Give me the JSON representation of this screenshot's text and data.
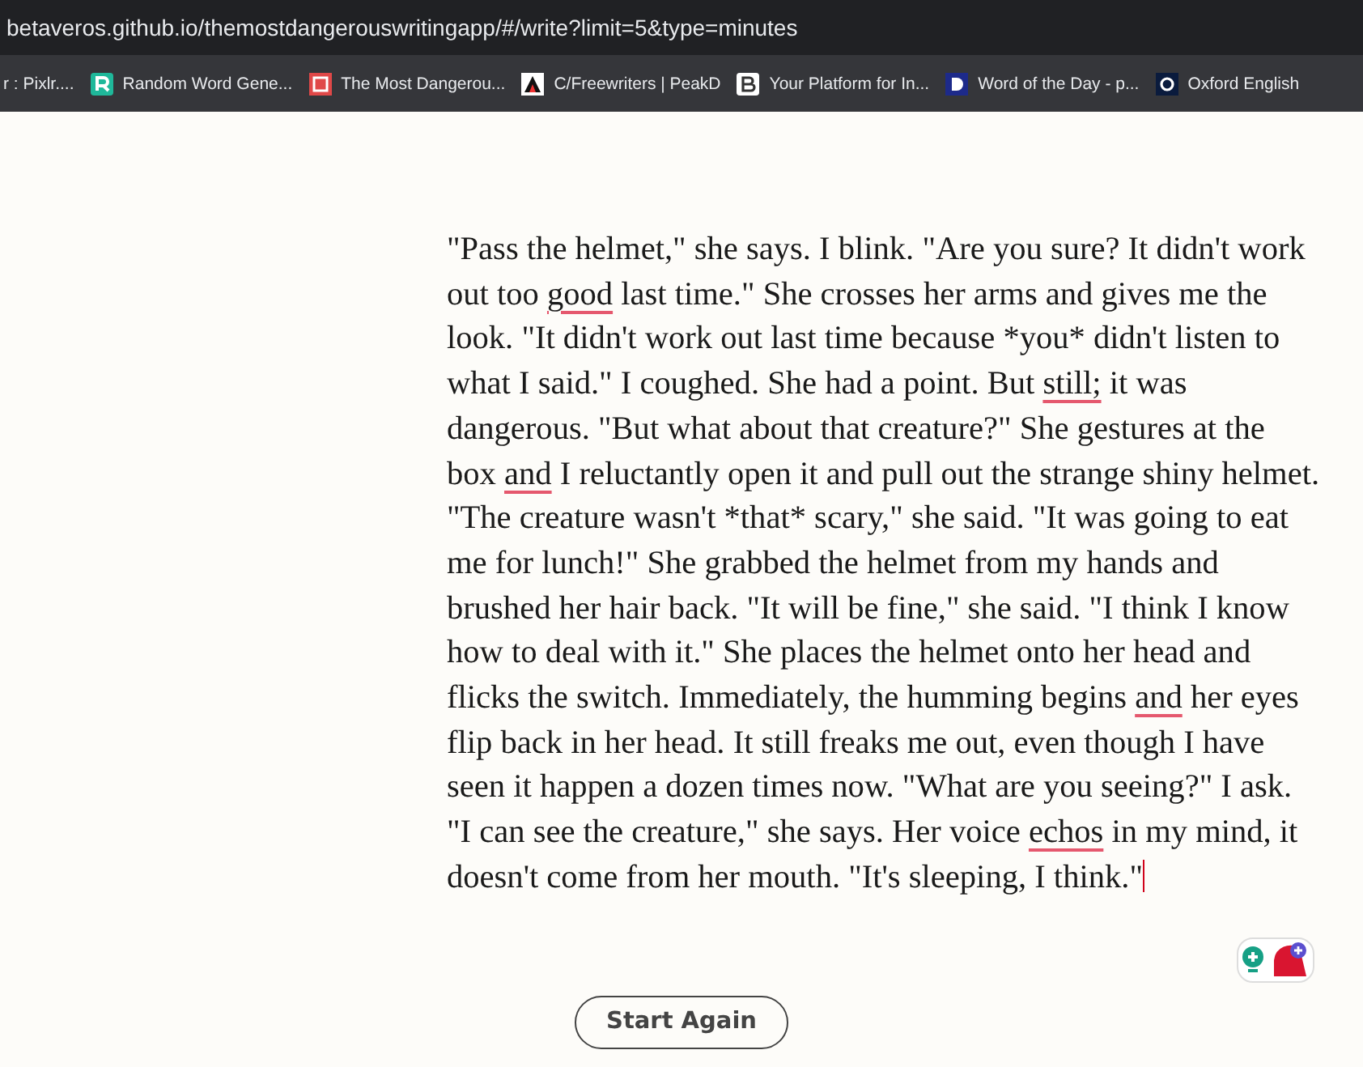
{
  "browser": {
    "url": "betaveros.github.io/themostdangerouswritingapp/#/write?limit=5&type=minutes",
    "bookmarks": [
      {
        "label": "r : Pixlr....",
        "kind": "none"
      },
      {
        "label": "Random Word Gene...",
        "kind": "r"
      },
      {
        "label": "The Most Dangerou...",
        "kind": "square"
      },
      {
        "label": "C/Freewriters | PeakD",
        "kind": "a"
      },
      {
        "label": "Your Platform for In...",
        "kind": "b"
      },
      {
        "label": "Word of the Day - p...",
        "kind": "d"
      },
      {
        "label": "Oxford English",
        "kind": "o"
      }
    ]
  },
  "editor": {
    "segments": [
      {
        "text": "\"Pass the helmet,\" she says. I blink. \"Are you sure? It didn't work out too ",
        "flagged": false
      },
      {
        "text": "good",
        "flagged": true
      },
      {
        "text": " last time.\" She crosses her arms and gives me the look. \"It didn't work out last time because *you* didn't listen to what I said.\" I coughed. She had a point. But ",
        "flagged": false
      },
      {
        "text": "still;",
        "flagged": true
      },
      {
        "text": " it was dangerous. \"But what about that creature?\" She gestures at the box ",
        "flagged": false
      },
      {
        "text": "and",
        "flagged": true
      },
      {
        "text": " I reluctantly open it and pull out the strange shiny helmet. \"The creature wasn't *that* scary,\" she said. \"It was going to eat me for lunch!\" She grabbed the helmet from my hands and brushed her hair back. \"It will be fine,\" she said. \"I think I know how to deal with it.\" She places the helmet onto her head and flicks the switch. Immediately, the humming begins ",
        "flagged": false
      },
      {
        "text": "and",
        "flagged": true
      },
      {
        "text": " her eyes flip back in her head. It still freaks me out, even though I have seen it happen a dozen times now. \"What are you seeing?\" I ask. \"I can see the creature,\" she says. Her voice ",
        "flagged": false
      },
      {
        "text": "echos",
        "flagged": true
      },
      {
        "text": " in my mind, it doesn't come from her mouth. \"It's sleeping, I think.\"",
        "flagged": false
      }
    ]
  },
  "start_button": "Start Again"
}
